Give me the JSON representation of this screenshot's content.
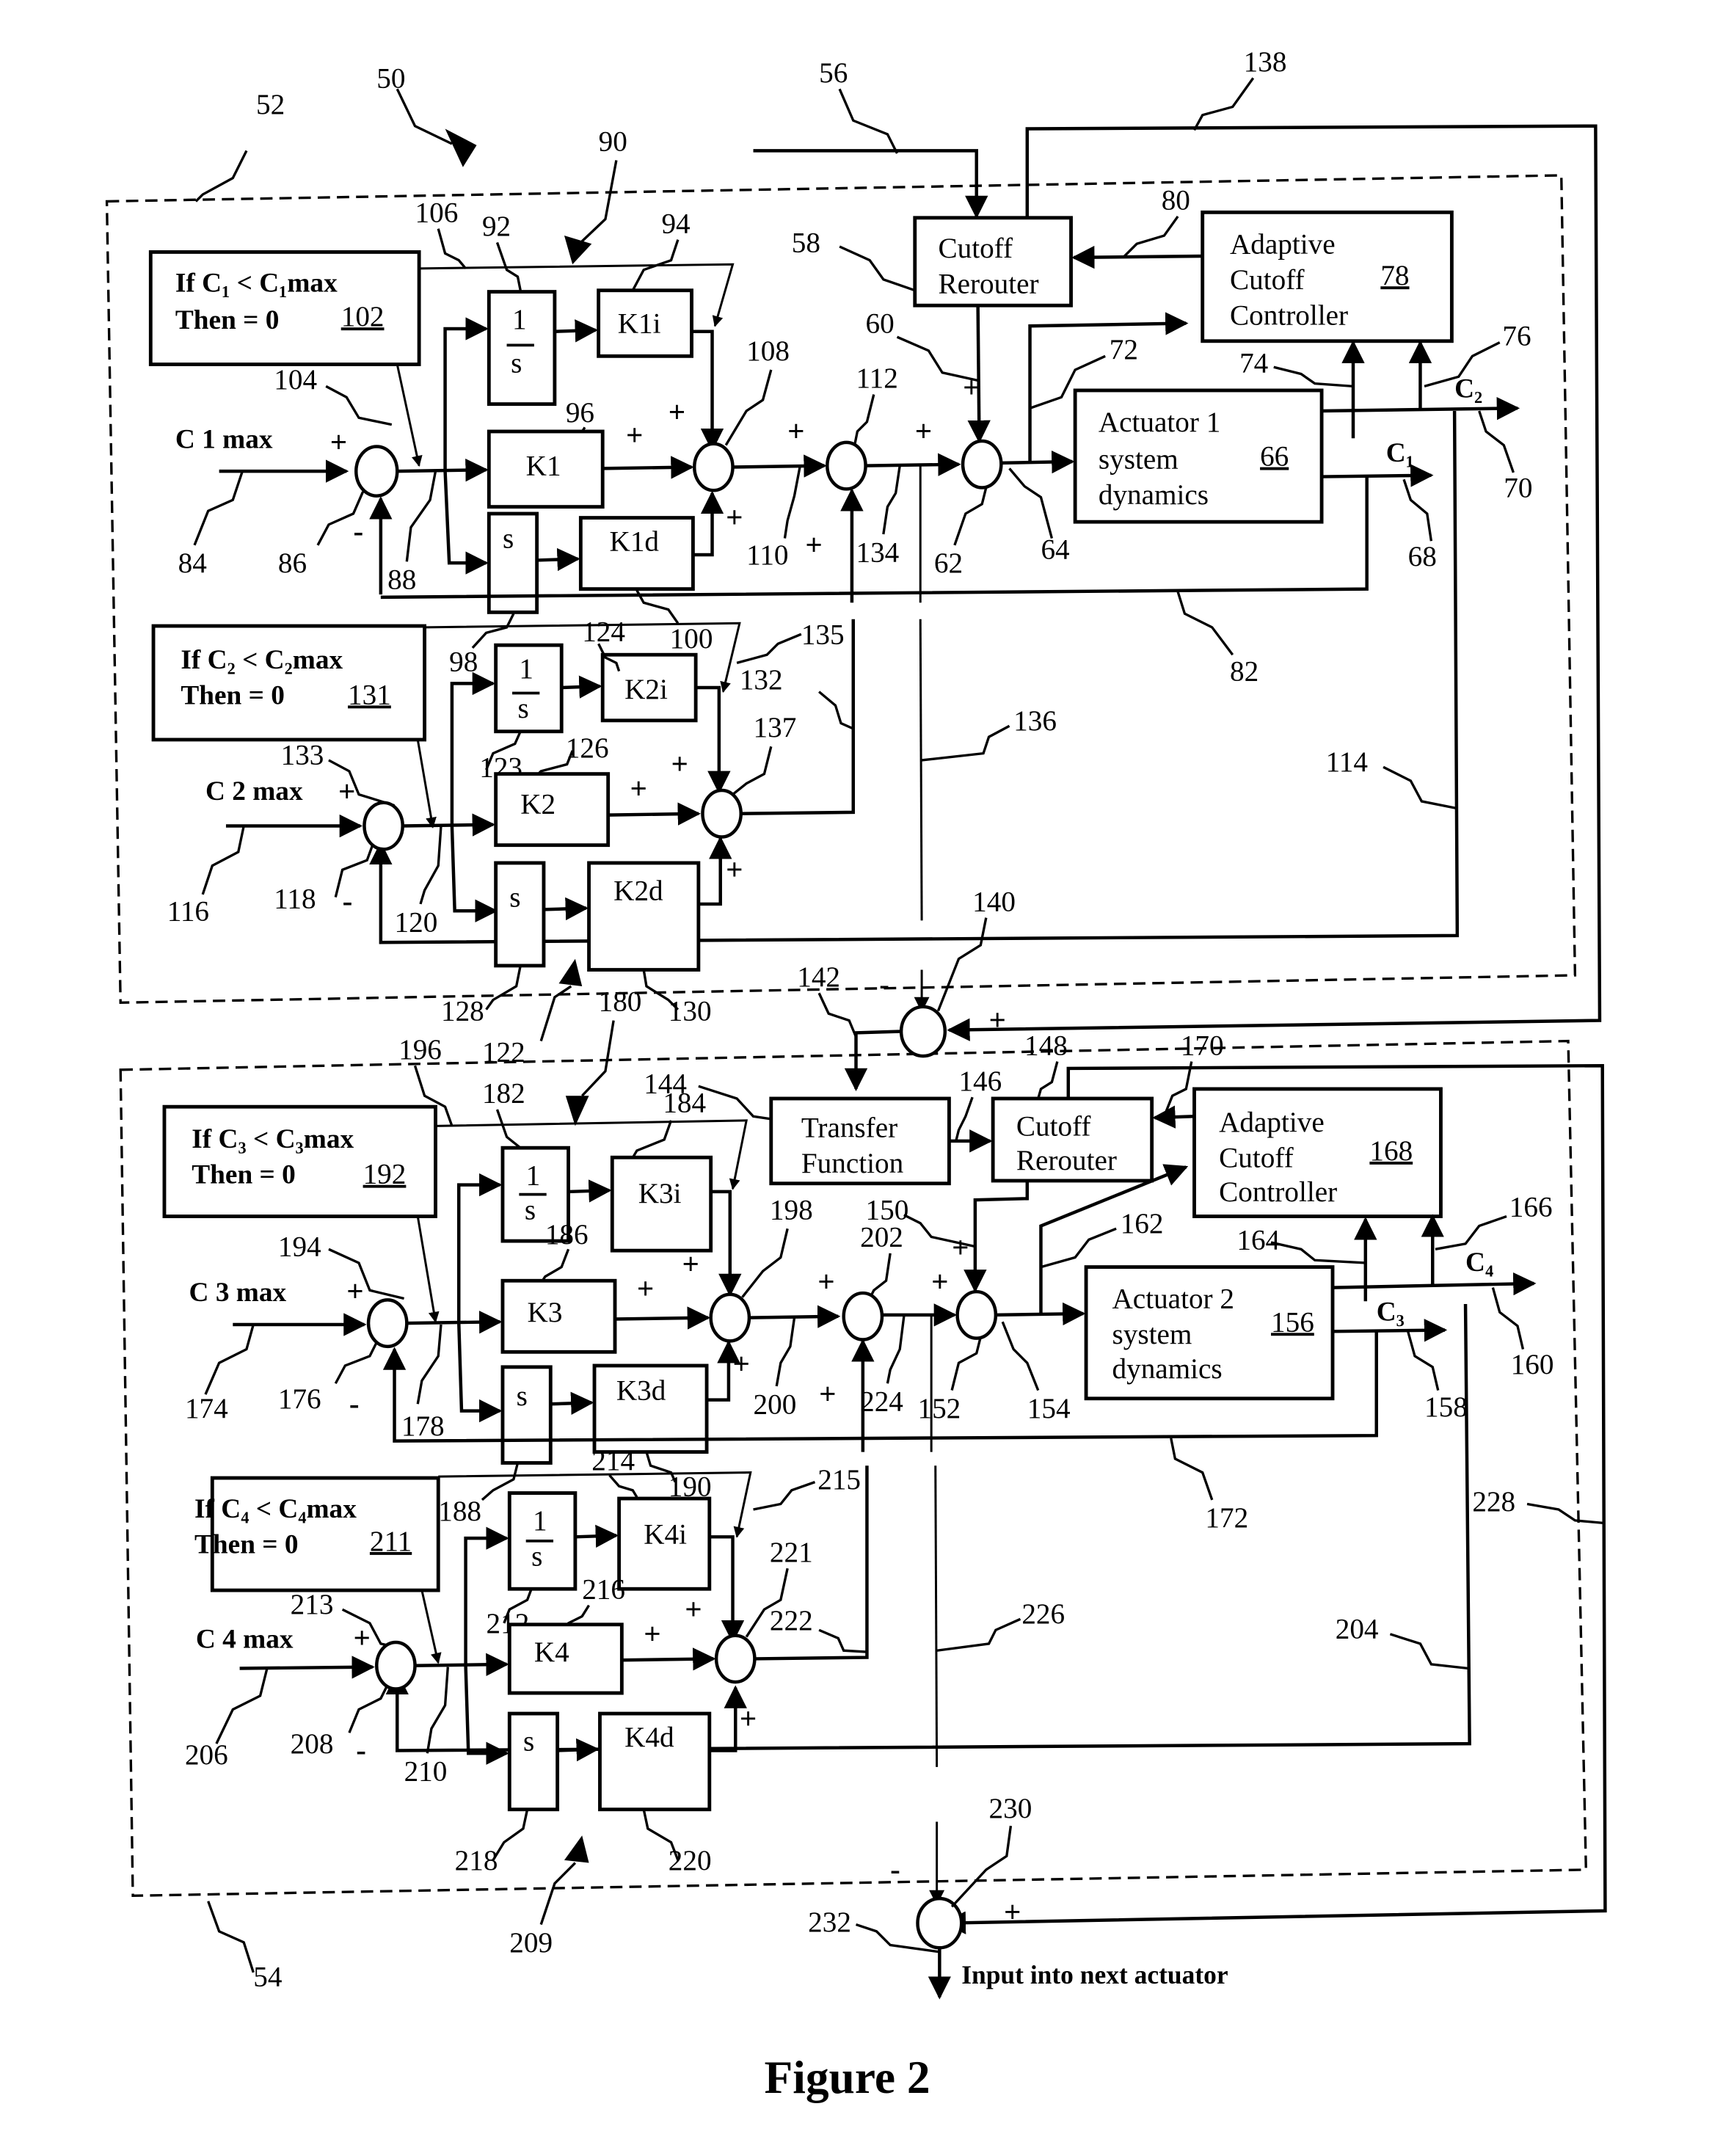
{
  "figure": {
    "title": "Figure 2",
    "output_note": "Input into next actuator"
  },
  "reference_numerals": {
    "system": "50",
    "upper_module": "52",
    "lower_module": "54",
    "input_56": "56",
    "cutoff_rerouter_1": "58",
    "line_60": "60",
    "sum_62": "62",
    "line_64": "64",
    "actuator_1": "66",
    "out_c1": "68",
    "out_c2": "70",
    "line_72": "72",
    "line_74": "74",
    "line_76": "76",
    "adaptive_ctrl_1": "78",
    "line_80": "80",
    "fb_82": "82",
    "input_84": "84",
    "sum_86": "86",
    "line_88": "88",
    "pid_90": "90",
    "integ_92": "92",
    "k1i": "94",
    "k1": "96",
    "deriv_98": "98",
    "k1d": "100",
    "cond_102": "102",
    "line_104": "104",
    "line_106": "106",
    "sum_108": "108",
    "line_110": "110",
    "sum_112": "112",
    "line_114": "114",
    "input_116": "116",
    "sum_118": "118",
    "line_120": "120",
    "pid_122": "122",
    "integ_123": "123",
    "k2i": "124",
    "k2": "126",
    "deriv_128": "128",
    "k2d": "130",
    "cond_131": "131",
    "line_132": "132",
    "line_133": "133",
    "line_134": "134",
    "line_135": "135",
    "line_136": "136",
    "sum_137": "137",
    "line_138": "138",
    "sum_140": "140",
    "line_142": "142",
    "tf_144": "144",
    "line_146": "146",
    "cutoff_rerouter_2": "148",
    "line_150": "150",
    "sum_152": "152",
    "line_154": "154",
    "actuator_2": "156",
    "out_c3": "158",
    "out_c4": "160",
    "line_162": "162",
    "line_164": "164",
    "line_166": "166",
    "adaptive_ctrl_2": "168",
    "line_170": "170",
    "fb_172": "172",
    "input_174": "174",
    "sum_176": "176",
    "line_178": "178",
    "pid_180": "180",
    "integ_182": "182",
    "k3i": "184",
    "k3": "186",
    "deriv_188": "188",
    "k3d": "190",
    "cond_192": "192",
    "line_194": "194",
    "line_196": "196",
    "sum_198": "198",
    "line_200": "200",
    "sum_202": "202",
    "line_204": "204",
    "input_206": "206",
    "sum_208": "208",
    "pid_209": "209",
    "line_210": "210",
    "cond_211": "211",
    "integ_212": "212",
    "line_213": "213",
    "k4i": "214",
    "line_215": "215",
    "k4": "216",
    "deriv_218": "218",
    "k4d": "220",
    "sum_221": "221",
    "line_222": "222",
    "line_224": "224",
    "line_226": "226",
    "line_228": "228",
    "sum_230": "230",
    "line_232": "232"
  },
  "blocks": {
    "cutoff_rerouter": [
      "Cutoff",
      "Rerouter"
    ],
    "adaptive_controller": [
      "Adaptive",
      "Cutoff",
      "Controller"
    ],
    "actuator_1": [
      "Actuator  1",
      "system",
      "dynamics"
    ],
    "actuator_2": [
      "Actuator  2",
      "system",
      "dynamics"
    ],
    "transfer_function": [
      "Transfer",
      "Function"
    ],
    "integrator": {
      "num": "1",
      "den": "s"
    },
    "differentiator": "s",
    "gains": {
      "k1i": "K1i",
      "k1": "K1",
      "k1d": "K1d",
      "k2i": "K2i",
      "k2": "K2",
      "k2d": "K2d",
      "k3i": "K3i",
      "k3": "K3",
      "k3d": "K3d",
      "k4i": "K4i",
      "k4": "K4",
      "k4d": "K4d"
    }
  },
  "conditions": {
    "c1": {
      "line1": "If C₁ < C₁max",
      "line2": "Then  =  0"
    },
    "c2": {
      "line1": "If C₂ < C₂max",
      "line2": "Then  =  0"
    },
    "c3": {
      "line1": "If C₃ < C₃max",
      "line2": "Then  =  0"
    },
    "c4": {
      "line1": "If C₄ < C₄max",
      "line2": "Then  =  0"
    }
  },
  "signals": {
    "c1_max": "C 1 max",
    "c2_max": "C 2 max",
    "c3_max": "C 3 max",
    "c4_max": "C 4 max",
    "c1": "C₁",
    "c2": "C₂",
    "c3": "C₃",
    "c4": "C₄",
    "plus": "+",
    "minus": "-"
  }
}
